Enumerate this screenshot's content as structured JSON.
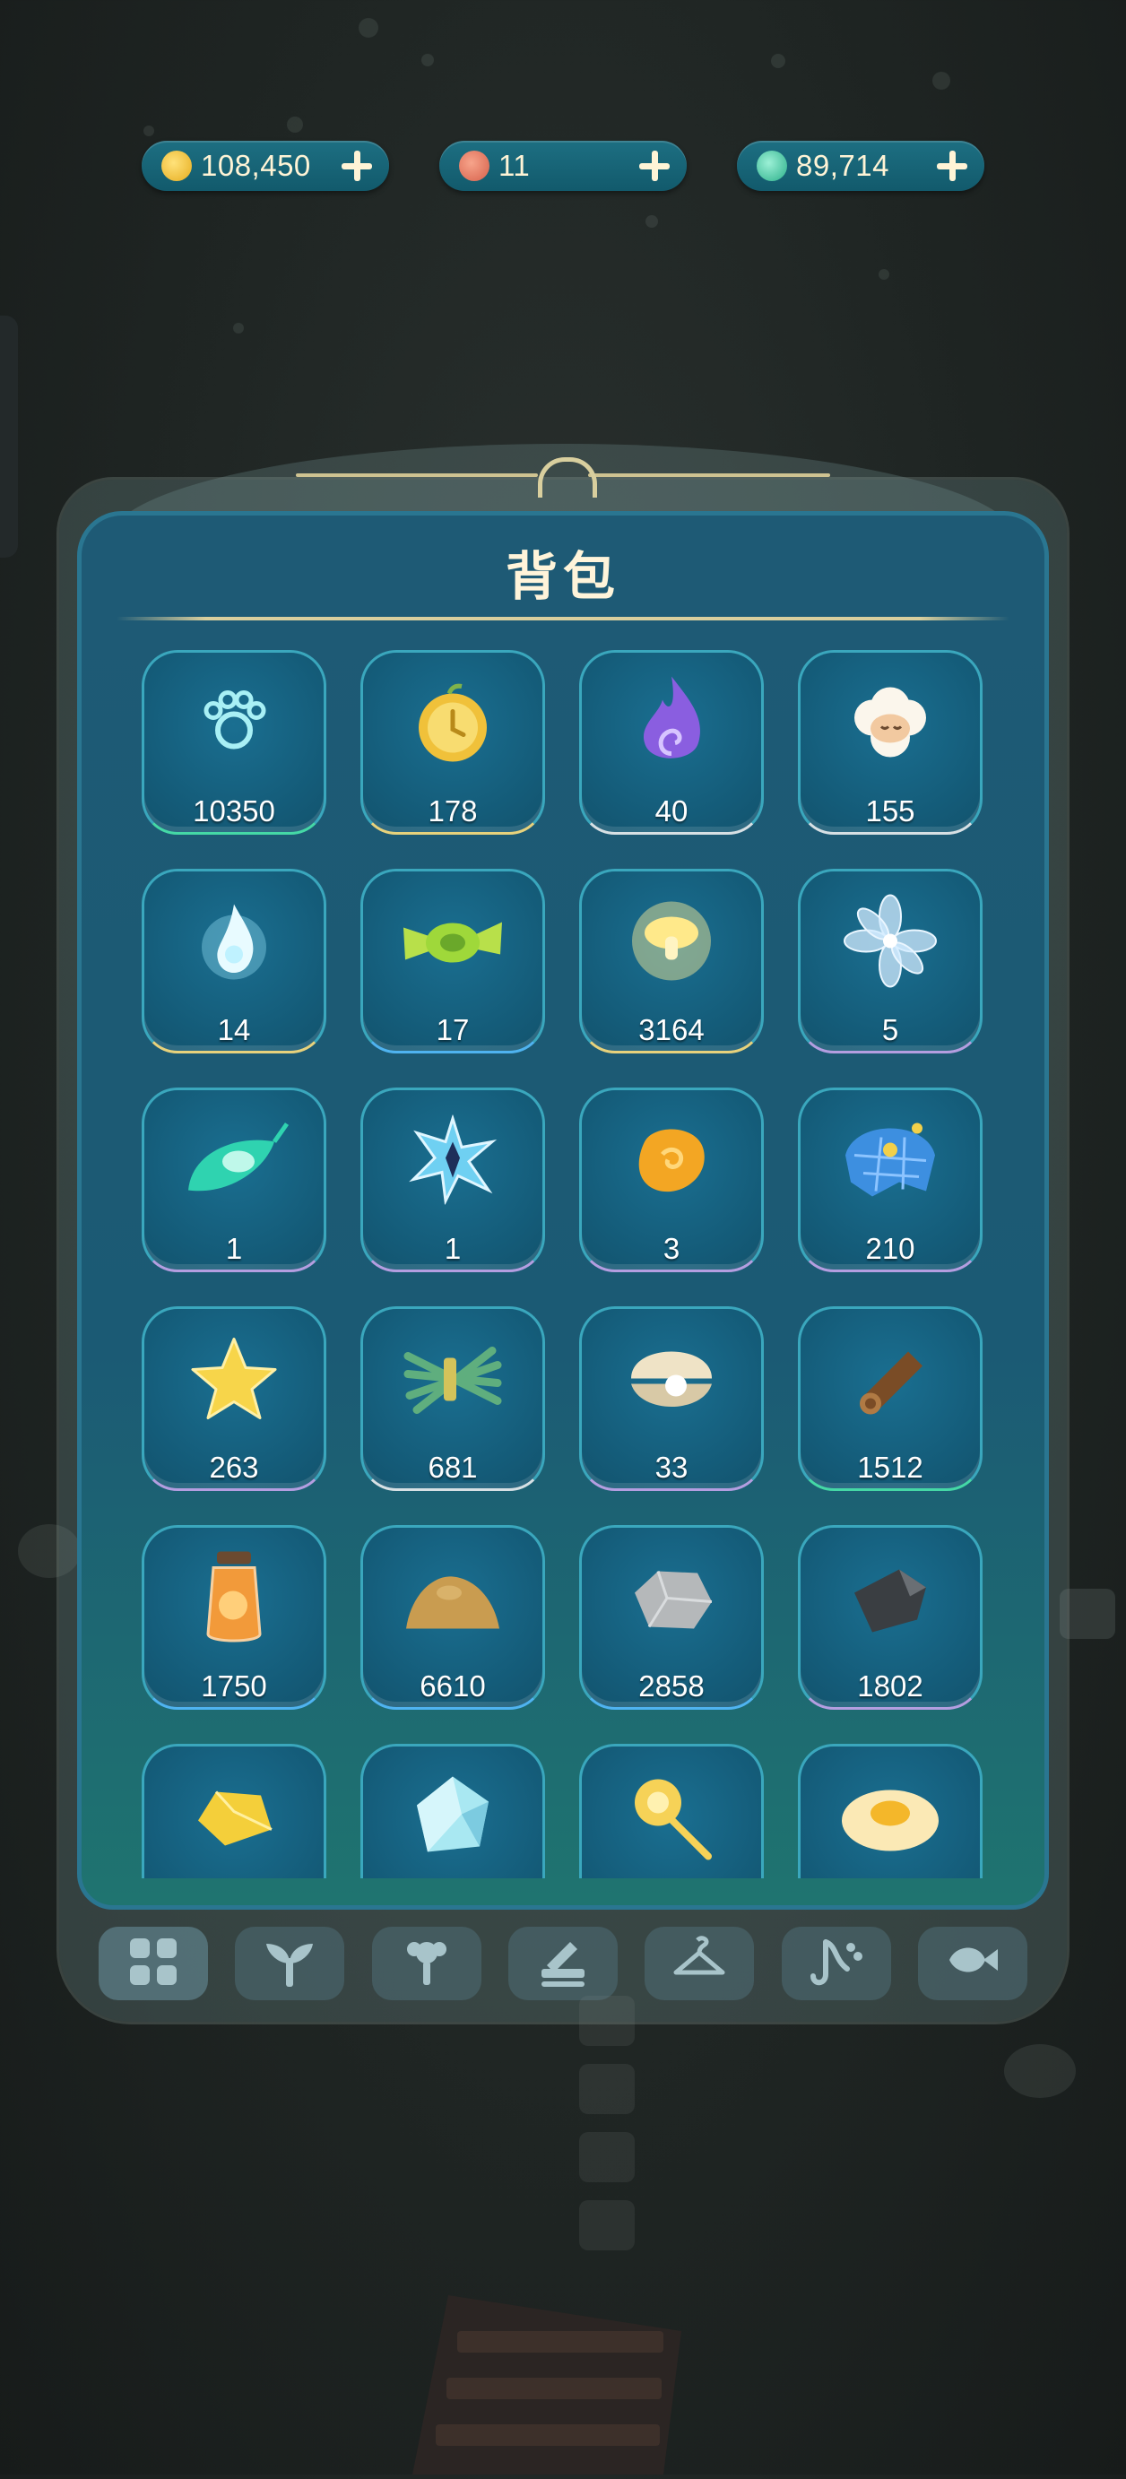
{
  "currencies": [
    {
      "name": "gold-coin-icon",
      "value": "108,450",
      "color": "#f2c744"
    },
    {
      "name": "red-gem-icon",
      "value": "11",
      "color": "#e6836a"
    },
    {
      "name": "star-crystal-icon",
      "value": "89,714",
      "color": "#5fd6b0"
    }
  ],
  "panel": {
    "title": "背包"
  },
  "items": [
    {
      "name": "paw-bubble-icon",
      "count": "10350",
      "rim": "green"
    },
    {
      "name": "golden-clock-fruit-icon",
      "count": "178",
      "rim": "gold"
    },
    {
      "name": "purple-flame-icon",
      "count": "40",
      "rim": "silver"
    },
    {
      "name": "sheep-icon",
      "count": "155",
      "rim": "silver"
    },
    {
      "name": "blue-spirit-flame-icon",
      "count": "14",
      "rim": "gold"
    },
    {
      "name": "green-candy-icon",
      "count": "17",
      "rim": "blue"
    },
    {
      "name": "glowing-mushroom-icon",
      "count": "3164",
      "rim": "gold"
    },
    {
      "name": "crystal-flower-icon",
      "count": "5",
      "rim": "purple"
    },
    {
      "name": "green-feather-icon",
      "count": "1",
      "rim": "purple"
    },
    {
      "name": "blue-star-crystal-icon",
      "count": "1",
      "rim": "purple"
    },
    {
      "name": "amber-stone-icon",
      "count": "3",
      "rim": "purple"
    },
    {
      "name": "blue-jellyfish-icon",
      "count": "210",
      "rim": "purple"
    },
    {
      "name": "star-icon",
      "count": "263",
      "rim": "purple"
    },
    {
      "name": "grass-bundle-icon",
      "count": "681",
      "rim": "silver"
    },
    {
      "name": "pearl-shell-icon",
      "count": "33",
      "rim": "purple"
    },
    {
      "name": "wood-log-icon",
      "count": "1512",
      "rim": "green"
    },
    {
      "name": "honey-jar-icon",
      "count": "1750",
      "rim": "blue"
    },
    {
      "name": "sand-pile-icon",
      "count": "6610",
      "rim": "blue"
    },
    {
      "name": "gray-stone-icon",
      "count": "2858",
      "rim": "blue"
    },
    {
      "name": "coal-block-icon",
      "count": "1802",
      "rim": "purple"
    },
    {
      "name": "gold-nugget-icon",
      "count": "",
      "rim": "blue"
    },
    {
      "name": "diamond-icon",
      "count": "",
      "rim": "blue"
    },
    {
      "name": "golden-wand-icon",
      "count": "",
      "rim": "blue"
    },
    {
      "name": "fried-egg-icon",
      "count": "",
      "rim": "blue"
    }
  ],
  "tabs": [
    {
      "name": "tab-all-grid-icon",
      "active": true
    },
    {
      "name": "tab-sprout-icon",
      "active": false
    },
    {
      "name": "tab-flower-pot-icon",
      "active": false
    },
    {
      "name": "tab-tools-icon",
      "active": false
    },
    {
      "name": "tab-hanger-icon",
      "active": false
    },
    {
      "name": "tab-music-icon",
      "active": false
    },
    {
      "name": "tab-fish-icon",
      "active": false
    }
  ]
}
